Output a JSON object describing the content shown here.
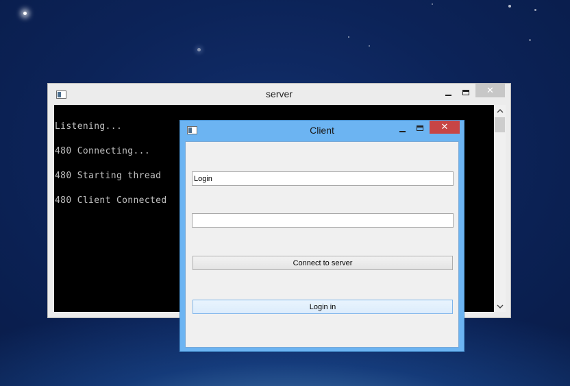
{
  "server_window": {
    "title": "server",
    "minimize_glyph": "",
    "close_glyph": "✕",
    "console_lines": [
      "Listening...",
      "480 Connecting...",
      "480 Starting thread",
      "480 Client Connected"
    ],
    "scroll_up_glyph": "︿",
    "scroll_down_glyph": "﹀"
  },
  "client_window": {
    "title": "Client",
    "close_glyph": "✕",
    "login_input": {
      "value": "Login"
    },
    "password_input": {
      "value": ""
    },
    "connect_button_label": "Connect to server",
    "login_button_label": "Login in"
  },
  "icons": {
    "app_icon": "console-app-icon",
    "minimize": "minimize-icon",
    "maximize": "maximize-icon",
    "close": "close-icon"
  },
  "colors": {
    "client_frame": "#6cb4f2",
    "close_active": "#c74545",
    "console_bg": "#000000",
    "console_text": "#c0c0c0"
  }
}
